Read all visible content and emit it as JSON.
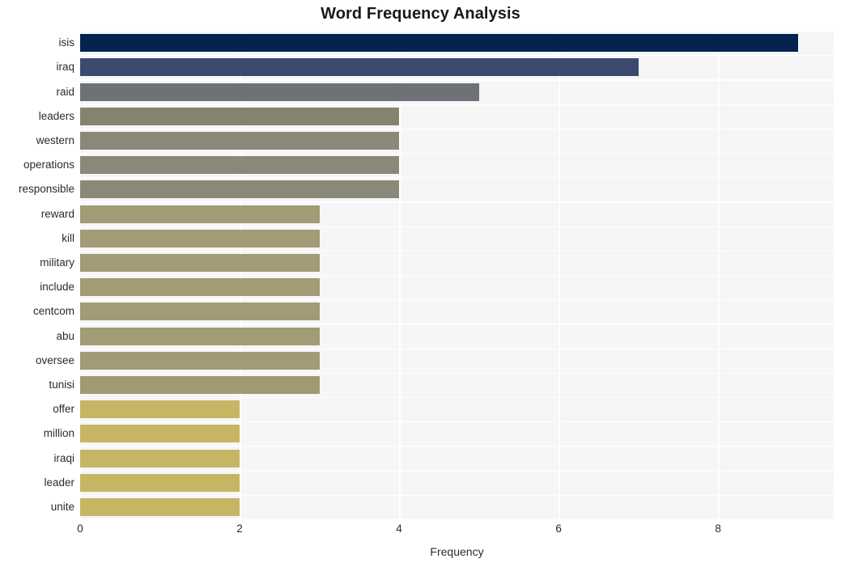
{
  "chart_data": {
    "type": "bar",
    "orientation": "horizontal",
    "title": "Word Frequency Analysis",
    "xlabel": "Frequency",
    "ylabel": "",
    "xlim": [
      0,
      9.45
    ],
    "xticks": [
      0,
      2,
      4,
      6,
      8
    ],
    "xtick_labels": [
      "0",
      "2",
      "4",
      "6",
      "8"
    ],
    "grid": true,
    "legend": null,
    "categories": [
      "isis",
      "iraq",
      "raid",
      "leaders",
      "western",
      "operations",
      "responsible",
      "reward",
      "kill",
      "military",
      "include",
      "centcom",
      "abu",
      "oversee",
      "tunisi",
      "offer",
      "million",
      "iraqi",
      "leader",
      "unite"
    ],
    "values": [
      9,
      7,
      5,
      4,
      4,
      4,
      4,
      3,
      3,
      3,
      3,
      3,
      3,
      3,
      3,
      2,
      2,
      2,
      2,
      2
    ],
    "bar_colors": [
      "#04234f",
      "#3c4a70",
      "#6e7175",
      "#85836f",
      "#8a8878",
      "#8a8878",
      "#8a8878",
      "#a19b76",
      "#a19b76",
      "#a19b76",
      "#a19b76",
      "#a19b76",
      "#a19b76",
      "#a19b76",
      "#a09a74",
      "#c6b664",
      "#c6b664",
      "#c6b664",
      "#c6b664",
      "#c6b664"
    ],
    "plot_background": "#f6f6f7",
    "grid_color": "#ffffff",
    "text_color": "#2b2b2b"
  }
}
